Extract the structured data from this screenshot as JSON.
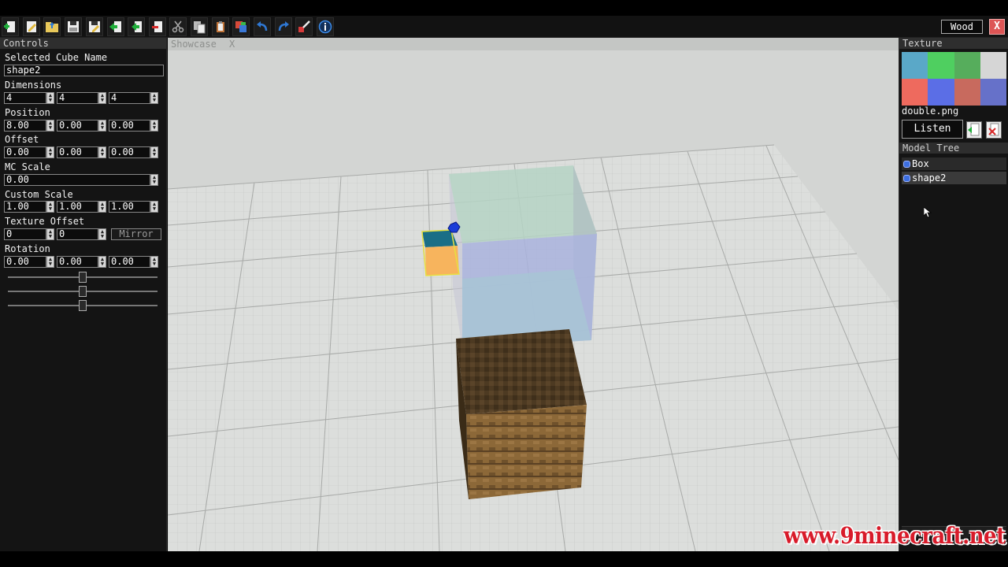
{
  "toolbar": {
    "buttons": [
      {
        "name": "new-project-button",
        "icon": "plus-page-icon"
      },
      {
        "name": "edit-button",
        "icon": "pencil-page-icon"
      },
      {
        "name": "open-button",
        "icon": "folder-icon"
      },
      {
        "name": "save-button",
        "icon": "floppy-icon"
      },
      {
        "name": "save-as-button",
        "icon": "floppy-pencil-icon"
      },
      {
        "name": "import-button",
        "icon": "import-arrow-icon"
      },
      {
        "name": "export-button",
        "icon": "export-arrow-icon"
      },
      {
        "name": "delete-button",
        "icon": "delete-page-icon"
      },
      {
        "name": "cut-button",
        "icon": "scissors-icon"
      },
      {
        "name": "copy-button",
        "icon": "copy-icon"
      },
      {
        "name": "paste-button",
        "icon": "clipboard-icon"
      },
      {
        "name": "texture-button",
        "icon": "texture-icon"
      },
      {
        "name": "undo-button",
        "icon": "undo-icon"
      },
      {
        "name": "redo-button",
        "icon": "redo-icon"
      },
      {
        "name": "settings-button",
        "icon": "tools-icon"
      },
      {
        "name": "info-button",
        "icon": "info-icon"
      }
    ],
    "texture_select": "Wood",
    "close_label": "X"
  },
  "controls": {
    "header": "Controls",
    "selected_cube_label": "Selected Cube Name",
    "selected_cube_value": "shape2",
    "dimensions_label": "Dimensions",
    "dimensions": [
      "4",
      "4",
      "4"
    ],
    "position_label": "Position",
    "position": [
      "8.00",
      "0.00",
      "0.00"
    ],
    "offset_label": "Offset",
    "offset": [
      "0.00",
      "0.00",
      "0.00"
    ],
    "mc_scale_label": "MC Scale",
    "mc_scale": "0.00",
    "custom_scale_label": "Custom Scale",
    "custom_scale": [
      "1.00",
      "1.00",
      "1.00"
    ],
    "texture_offset_label": "Texture Offset",
    "texture_offset": [
      "0",
      "0"
    ],
    "mirror_label": "Mirror",
    "rotation_label": "Rotation",
    "rotation": [
      "0.00",
      "0.00",
      "0.00"
    ],
    "rotation_sliders": [
      0.5,
      0.5,
      0.5
    ]
  },
  "viewport": {
    "tab_label": "Showcase",
    "tab_close": "X"
  },
  "texture_panel": {
    "header": "Texture",
    "swatches": [
      "#5aa8c8",
      "#4fcf60",
      "#56ad5c",
      "#d6d6d6",
      "#ee6a5e",
      "#5b6ee6",
      "#c86a5e",
      "#6671c9"
    ],
    "file_name": "double.png",
    "listen_label": "Listen"
  },
  "model_tree": {
    "header": "Model Tree",
    "items": [
      "Box",
      "shape2"
    ]
  },
  "watermark": "www.9minecraft.net"
}
